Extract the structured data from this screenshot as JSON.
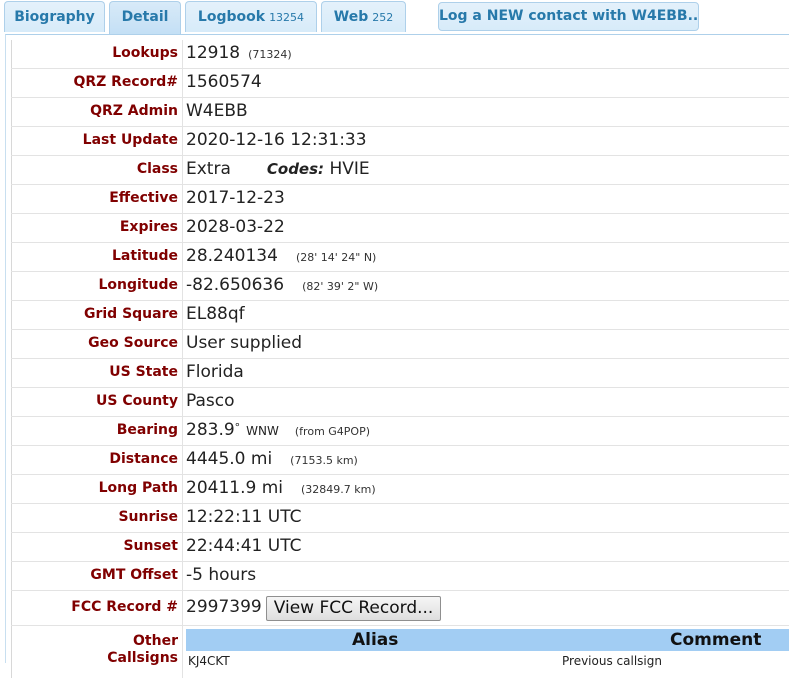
{
  "tabs": {
    "biography": "Biography",
    "detail": "Detail",
    "logbook": "Logbook",
    "logbook_count": "13254",
    "web": "Web",
    "web_count": "252",
    "log_button": "Log a NEW contact with W4EBB..."
  },
  "detail": {
    "lookups": {
      "label": "Lookups",
      "value": "12918",
      "extra": "(71324)"
    },
    "qrz_record": {
      "label": "QRZ Record#",
      "value": "1560574"
    },
    "qrz_admin": {
      "label": "QRZ Admin",
      "value": "W4EBB"
    },
    "last_update": {
      "label": "Last Update",
      "value": "2020-12-16 12:31:33"
    },
    "class": {
      "label": "Class",
      "value": "Extra",
      "codes_label": "Codes:",
      "codes_value": "HVIE"
    },
    "effective": {
      "label": "Effective",
      "value": "2017-12-23"
    },
    "expires": {
      "label": "Expires",
      "value": "2028-03-22"
    },
    "latitude": {
      "label": "Latitude",
      "value": "28.240134",
      "extra": "(28' 14' 24\" N)"
    },
    "longitude": {
      "label": "Longitude",
      "value": "-82.650636",
      "extra": "(82' 39' 2\" W)"
    },
    "grid_square": {
      "label": "Grid Square",
      "value": "EL88qf"
    },
    "geo_source": {
      "label": "Geo Source",
      "value": "User supplied"
    },
    "us_state": {
      "label": "US State",
      "value": "Florida"
    },
    "us_county": {
      "label": "US County",
      "value": "Pasco"
    },
    "bearing": {
      "label": "Bearing",
      "value": "283.9",
      "degree": "°",
      "dir": "WNW",
      "extra": "(from G4POP)"
    },
    "distance": {
      "label": "Distance",
      "value": "4445.0 mi",
      "extra": "(7153.5 km)"
    },
    "long_path": {
      "label": "Long Path",
      "value": "20411.9 mi",
      "extra": "(32849.7 km)"
    },
    "sunrise": {
      "label": "Sunrise",
      "value": "12:22:11 UTC"
    },
    "sunset": {
      "label": "Sunset",
      "value": "22:44:41 UTC"
    },
    "gmt_offset": {
      "label": "GMT Offset",
      "value": "-5 hours"
    },
    "fcc_record": {
      "label": "FCC Record #",
      "value": "2997399",
      "button": "View FCC Record..."
    },
    "other_callsigns": {
      "label_line1": "Other",
      "label_line2": "Callsigns",
      "headers": {
        "alias": "Alias",
        "comment": "Comment"
      },
      "rows": [
        {
          "alias": "KJ4CKT",
          "comment": "Previous callsign"
        }
      ]
    }
  }
}
